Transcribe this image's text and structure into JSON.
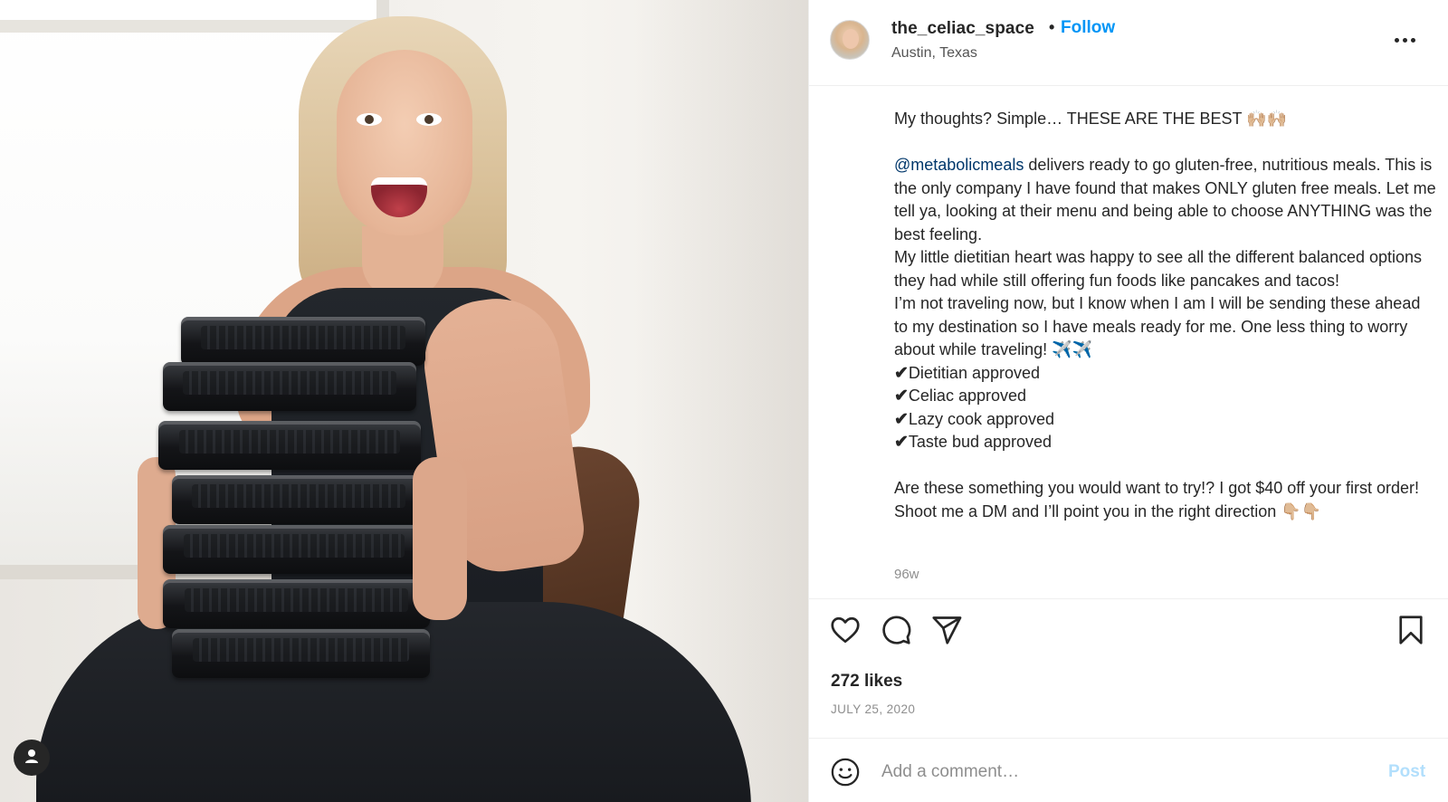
{
  "post": {
    "username": "the_celiac_space",
    "separator": "•",
    "follow_label": "Follow",
    "location": "Austin, Texas",
    "caption": {
      "line1": "My thoughts? Simple… THESE ARE THE BEST 🙌🏼🙌🏼",
      "mention": "@metabolicmeals",
      "para2_rest": " delivers ready to go gluten-free, nutritious meals. This is the only company I have found that makes ONLY gluten free meals. Let me tell ya, looking at their menu and being able to choose ANYTHING was the best feeling.",
      "para3": "My little dietitian heart was happy to see all the different balanced options they had while still offering fun foods like pancakes and tacos!",
      "para4": "I’m not traveling now, but I know when I am I will be sending these ahead to my destination so I have meals ready for me. One less thing to worry about while traveling! ✈️✈️",
      "checklist": [
        {
          "mark": "✔",
          "text": "Dietitian approved"
        },
        {
          "mark": "✔",
          "text": "Celiac approved"
        },
        {
          "mark": "✔",
          "text": "Lazy cook approved"
        },
        {
          "mark": "✔",
          "text": "Taste bud approved"
        }
      ],
      "closing": "Are these something you would want to try!? I got $40 off your first order! Shoot me a DM and I’ll point you in the right direction 👇🏼👇🏼"
    },
    "time_ago": "96w",
    "likes": "272 likes",
    "date": "JULY 25, 2020",
    "comment": {
      "placeholder": "Add a comment…",
      "post_label": "Post"
    }
  },
  "icons": {
    "like": "heart-icon",
    "comment": "speech-bubble-icon",
    "share": "paper-plane-icon",
    "save": "bookmark-icon",
    "more": "more-options-icon",
    "emoji": "smiley-icon",
    "tagged_user": "user-icon"
  },
  "colors": {
    "link_blue": "#0095f6",
    "mention_blue": "#00376b",
    "post_disabled": "#b2dffc",
    "muted_text": "#8e8e8e"
  }
}
